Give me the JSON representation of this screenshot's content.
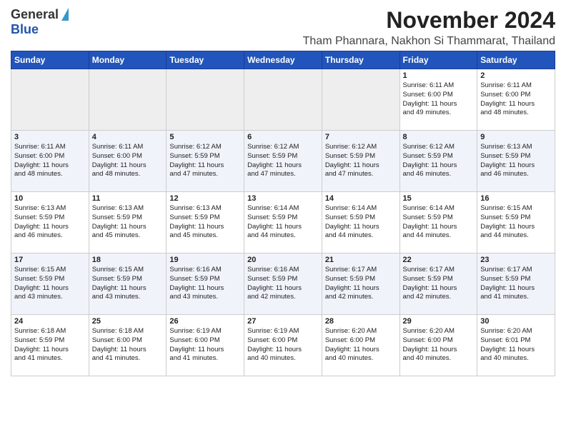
{
  "logo": {
    "general": "General",
    "blue": "Blue"
  },
  "title": "November 2024",
  "location": "Tham Phannara, Nakhon Si Thammarat, Thailand",
  "days_of_week": [
    "Sunday",
    "Monday",
    "Tuesday",
    "Wednesday",
    "Thursday",
    "Friday",
    "Saturday"
  ],
  "weeks": [
    [
      {
        "day": "",
        "info": ""
      },
      {
        "day": "",
        "info": ""
      },
      {
        "day": "",
        "info": ""
      },
      {
        "day": "",
        "info": ""
      },
      {
        "day": "",
        "info": ""
      },
      {
        "day": "1",
        "info": "Sunrise: 6:11 AM\nSunset: 6:00 PM\nDaylight: 11 hours\nand 49 minutes."
      },
      {
        "day": "2",
        "info": "Sunrise: 6:11 AM\nSunset: 6:00 PM\nDaylight: 11 hours\nand 48 minutes."
      }
    ],
    [
      {
        "day": "3",
        "info": "Sunrise: 6:11 AM\nSunset: 6:00 PM\nDaylight: 11 hours\nand 48 minutes."
      },
      {
        "day": "4",
        "info": "Sunrise: 6:11 AM\nSunset: 6:00 PM\nDaylight: 11 hours\nand 48 minutes."
      },
      {
        "day": "5",
        "info": "Sunrise: 6:12 AM\nSunset: 5:59 PM\nDaylight: 11 hours\nand 47 minutes."
      },
      {
        "day": "6",
        "info": "Sunrise: 6:12 AM\nSunset: 5:59 PM\nDaylight: 11 hours\nand 47 minutes."
      },
      {
        "day": "7",
        "info": "Sunrise: 6:12 AM\nSunset: 5:59 PM\nDaylight: 11 hours\nand 47 minutes."
      },
      {
        "day": "8",
        "info": "Sunrise: 6:12 AM\nSunset: 5:59 PM\nDaylight: 11 hours\nand 46 minutes."
      },
      {
        "day": "9",
        "info": "Sunrise: 6:13 AM\nSunset: 5:59 PM\nDaylight: 11 hours\nand 46 minutes."
      }
    ],
    [
      {
        "day": "10",
        "info": "Sunrise: 6:13 AM\nSunset: 5:59 PM\nDaylight: 11 hours\nand 46 minutes."
      },
      {
        "day": "11",
        "info": "Sunrise: 6:13 AM\nSunset: 5:59 PM\nDaylight: 11 hours\nand 45 minutes."
      },
      {
        "day": "12",
        "info": "Sunrise: 6:13 AM\nSunset: 5:59 PM\nDaylight: 11 hours\nand 45 minutes."
      },
      {
        "day": "13",
        "info": "Sunrise: 6:14 AM\nSunset: 5:59 PM\nDaylight: 11 hours\nand 44 minutes."
      },
      {
        "day": "14",
        "info": "Sunrise: 6:14 AM\nSunset: 5:59 PM\nDaylight: 11 hours\nand 44 minutes."
      },
      {
        "day": "15",
        "info": "Sunrise: 6:14 AM\nSunset: 5:59 PM\nDaylight: 11 hours\nand 44 minutes."
      },
      {
        "day": "16",
        "info": "Sunrise: 6:15 AM\nSunset: 5:59 PM\nDaylight: 11 hours\nand 44 minutes."
      }
    ],
    [
      {
        "day": "17",
        "info": "Sunrise: 6:15 AM\nSunset: 5:59 PM\nDaylight: 11 hours\nand 43 minutes."
      },
      {
        "day": "18",
        "info": "Sunrise: 6:15 AM\nSunset: 5:59 PM\nDaylight: 11 hours\nand 43 minutes."
      },
      {
        "day": "19",
        "info": "Sunrise: 6:16 AM\nSunset: 5:59 PM\nDaylight: 11 hours\nand 43 minutes."
      },
      {
        "day": "20",
        "info": "Sunrise: 6:16 AM\nSunset: 5:59 PM\nDaylight: 11 hours\nand 42 minutes."
      },
      {
        "day": "21",
        "info": "Sunrise: 6:17 AM\nSunset: 5:59 PM\nDaylight: 11 hours\nand 42 minutes."
      },
      {
        "day": "22",
        "info": "Sunrise: 6:17 AM\nSunset: 5:59 PM\nDaylight: 11 hours\nand 42 minutes."
      },
      {
        "day": "23",
        "info": "Sunrise: 6:17 AM\nSunset: 5:59 PM\nDaylight: 11 hours\nand 41 minutes."
      }
    ],
    [
      {
        "day": "24",
        "info": "Sunrise: 6:18 AM\nSunset: 5:59 PM\nDaylight: 11 hours\nand 41 minutes."
      },
      {
        "day": "25",
        "info": "Sunrise: 6:18 AM\nSunset: 6:00 PM\nDaylight: 11 hours\nand 41 minutes."
      },
      {
        "day": "26",
        "info": "Sunrise: 6:19 AM\nSunset: 6:00 PM\nDaylight: 11 hours\nand 41 minutes."
      },
      {
        "day": "27",
        "info": "Sunrise: 6:19 AM\nSunset: 6:00 PM\nDaylight: 11 hours\nand 40 minutes."
      },
      {
        "day": "28",
        "info": "Sunrise: 6:20 AM\nSunset: 6:00 PM\nDaylight: 11 hours\nand 40 minutes."
      },
      {
        "day": "29",
        "info": "Sunrise: 6:20 AM\nSunset: 6:00 PM\nDaylight: 11 hours\nand 40 minutes."
      },
      {
        "day": "30",
        "info": "Sunrise: 6:20 AM\nSunset: 6:01 PM\nDaylight: 11 hours\nand 40 minutes."
      }
    ]
  ]
}
